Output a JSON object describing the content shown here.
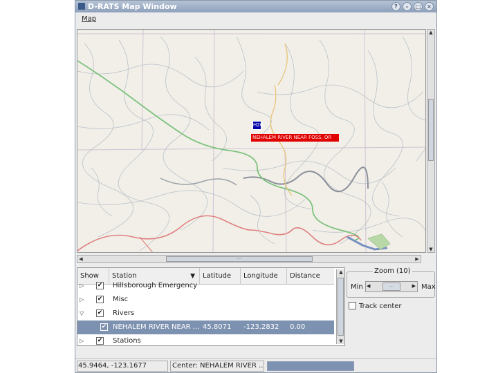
{
  "window": {
    "title": "D-RATS Map Window"
  },
  "menu": {
    "map_label": "Map"
  },
  "map": {
    "station_badge": "H2O",
    "station_label": "NEHALEM RIVER NEAR FOSS, OR"
  },
  "table": {
    "columns": [
      "Show",
      "Station",
      "Latitude",
      "Longitude",
      "Distance"
    ],
    "rows": [
      {
        "station": "Hillsborough Emergency ...",
        "latitude": "",
        "longitude": "",
        "distance": ""
      },
      {
        "station": "Misc",
        "latitude": "",
        "longitude": "",
        "distance": ""
      },
      {
        "station": "Rivers",
        "latitude": "",
        "longitude": "",
        "distance": ""
      },
      {
        "station": "NEHALEM RIVER NEAR ...",
        "latitude": "45.8071",
        "longitude": "-123.2832",
        "distance": "0.00"
      },
      {
        "station": "Stations",
        "latitude": "",
        "longitude": "",
        "distance": ""
      }
    ]
  },
  "zoom": {
    "title": "Zoom (10)",
    "min_label": "Min",
    "max_label": "Max"
  },
  "track": {
    "label": "Track center"
  },
  "status": {
    "coords": "45.9464, -123.1677",
    "center": "Center: NEHALEM RIVER ..."
  }
}
